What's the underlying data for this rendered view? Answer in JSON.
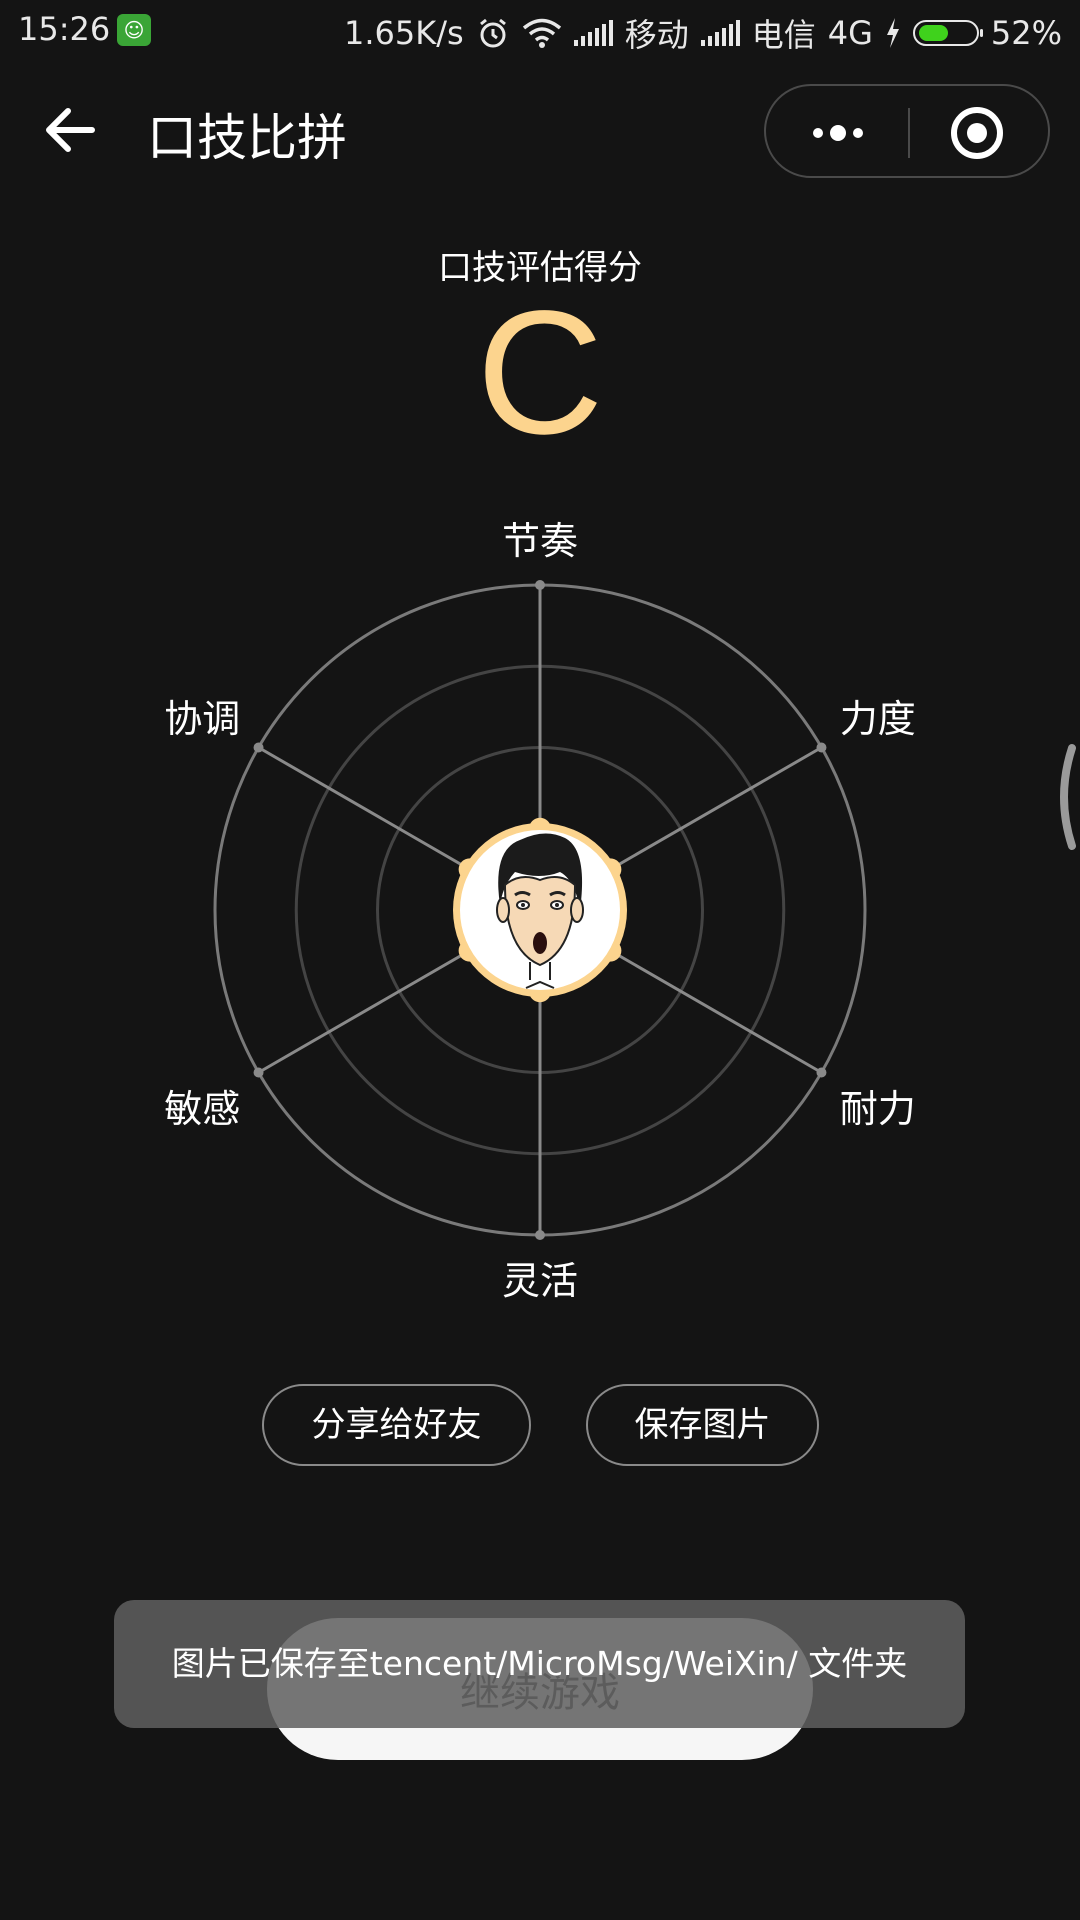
{
  "status_bar": {
    "time": "15:26",
    "net_speed": "1.65K/s",
    "carrier1": "移动",
    "carrier2": "电信",
    "network": "4G",
    "battery": "52%",
    "battery_level": 0.52
  },
  "nav": {
    "title": "口技比拼"
  },
  "score": {
    "label": "口技评估得分",
    "grade": "C"
  },
  "radar": {
    "axes": [
      "节奏",
      "力度",
      "耐力",
      "灵活",
      "敏感",
      "协调"
    ],
    "values": [
      0.25,
      0.25,
      0.25,
      0.25,
      0.25,
      0.25
    ],
    "accent": "#fcd48e"
  },
  "actions": {
    "share": "分享给好友",
    "save": "保存图片",
    "continue": "继续游戏"
  },
  "toast": {
    "message": "图片已保存至tencent/MicroMsg/WeiXin/ 文件夹"
  }
}
